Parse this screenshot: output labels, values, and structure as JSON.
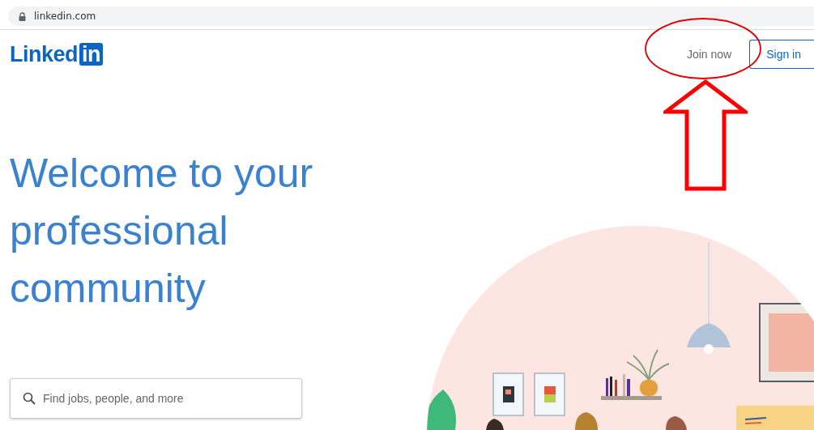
{
  "browser": {
    "address": "linkedin.com"
  },
  "header": {
    "logo": {
      "word": "Linked",
      "badge": "in"
    },
    "buttons": [
      {
        "label": "Join now",
        "kind": "plain"
      },
      {
        "label": "Sign in",
        "kind": "outline"
      }
    ]
  },
  "hero": {
    "headline": "Welcome to your professional community"
  },
  "search": {
    "placeholder": "Find jobs, people, and more"
  }
}
